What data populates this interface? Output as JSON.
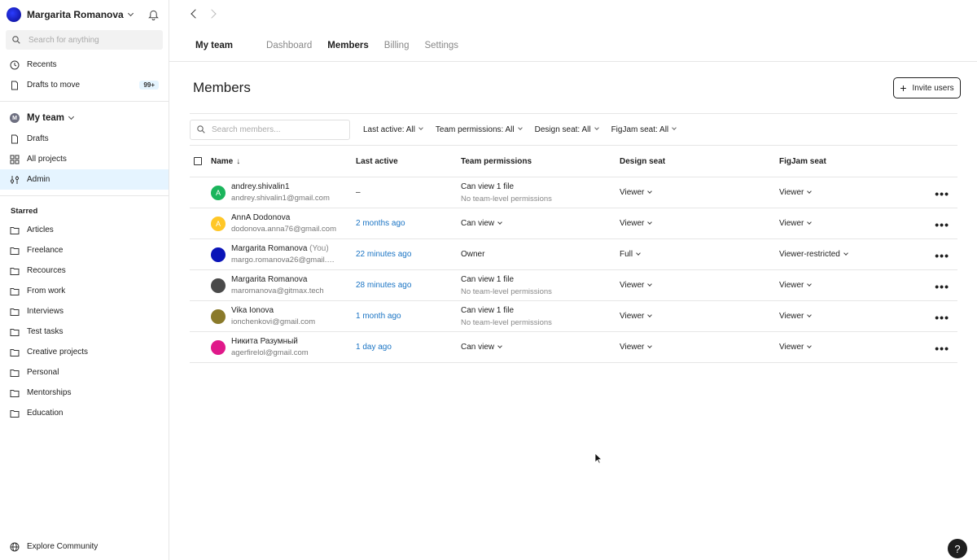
{
  "sidebar": {
    "user_name": "Margarita Romanova",
    "search_placeholder": "Search for anything",
    "top_items": [
      {
        "label": "Recents",
        "icon": "clock-icon"
      },
      {
        "label": "Drafts to move",
        "icon": "file-icon",
        "badge": "99+"
      }
    ],
    "team": {
      "initial": "M",
      "name": "My team"
    },
    "team_items": [
      {
        "label": "Drafts",
        "icon": "file-icon"
      },
      {
        "label": "All projects",
        "icon": "grid-icon"
      },
      {
        "label": "Admin",
        "icon": "sliders-icon"
      }
    ],
    "starred_label": "Starred",
    "starred_items": [
      "Articles",
      "Freelance",
      "Recources",
      "From work",
      "Interviews",
      "Test tasks",
      "Creative projects",
      "Personal",
      "Mentorships",
      "Education"
    ],
    "bottom_item": "Explore Community"
  },
  "topnav": {
    "team_tab": "My team",
    "tabs": [
      "Dashboard",
      "Members",
      "Billing",
      "Settings"
    ],
    "active_tab": "Members"
  },
  "page": {
    "title": "Members",
    "invite_label": "Invite users",
    "search_placeholder": "Search members...",
    "filters": [
      "Last active: All",
      "Team permissions: All",
      "Design seat: All",
      "FigJam seat: All"
    ]
  },
  "table": {
    "headers": {
      "name": "Name",
      "last": "Last active",
      "perm": "Team permissions",
      "design": "Design seat",
      "fig": "FigJam seat"
    },
    "rows": [
      {
        "name": "andrey.shivalin1",
        "you": "",
        "email": "andrey.shivalin1@gmail.com",
        "last": "–",
        "perm": "Can view 1 file",
        "perm_sub": "No team-level permissions",
        "design": "Viewer",
        "fig": "Viewer",
        "avatar_color": "#1bb55c",
        "avatar_letter": "A"
      },
      {
        "name": "AnnA Dodonova",
        "you": "",
        "email": "dodonova.anna76@gmail.com",
        "last": "2 months ago",
        "perm": "Can view",
        "perm_sub": "",
        "design": "Viewer",
        "fig": "Viewer",
        "avatar_color": "#ffc727",
        "avatar_letter": "A"
      },
      {
        "name": "Margarita Romanova",
        "you": "(You)",
        "email": "margo.romanova26@gmail.c...",
        "last": "22 minutes ago",
        "perm": "Owner",
        "perm_sub": "",
        "design": "Full",
        "fig": "Viewer-restricted",
        "avatar_color": "#0a14b8",
        "avatar_letter": ""
      },
      {
        "name": "Margarita Romanova",
        "you": "",
        "email": "maromanova@gitmax.tech",
        "last": "28 minutes ago",
        "perm": "Can view 1 file",
        "perm_sub": "No team-level permissions",
        "design": "Viewer",
        "fig": "Viewer",
        "avatar_color": "#4a4a4a",
        "avatar_letter": ""
      },
      {
        "name": "Vika Ionova",
        "you": "",
        "email": "ionchenkovi@gmail.com",
        "last": "1 month ago",
        "perm": "Can view 1 file",
        "perm_sub": "No team-level permissions",
        "design": "Viewer",
        "fig": "Viewer",
        "avatar_color": "#8a7a2a",
        "avatar_letter": ""
      },
      {
        "name": "Никита Разумный",
        "you": "",
        "email": "agerfirelol@gmail.com",
        "last": "1 day ago",
        "perm": "Can view",
        "perm_sub": "",
        "design": "Viewer",
        "fig": "Viewer",
        "avatar_color": "#e0188a",
        "avatar_letter": ""
      }
    ]
  },
  "help_label": "?"
}
